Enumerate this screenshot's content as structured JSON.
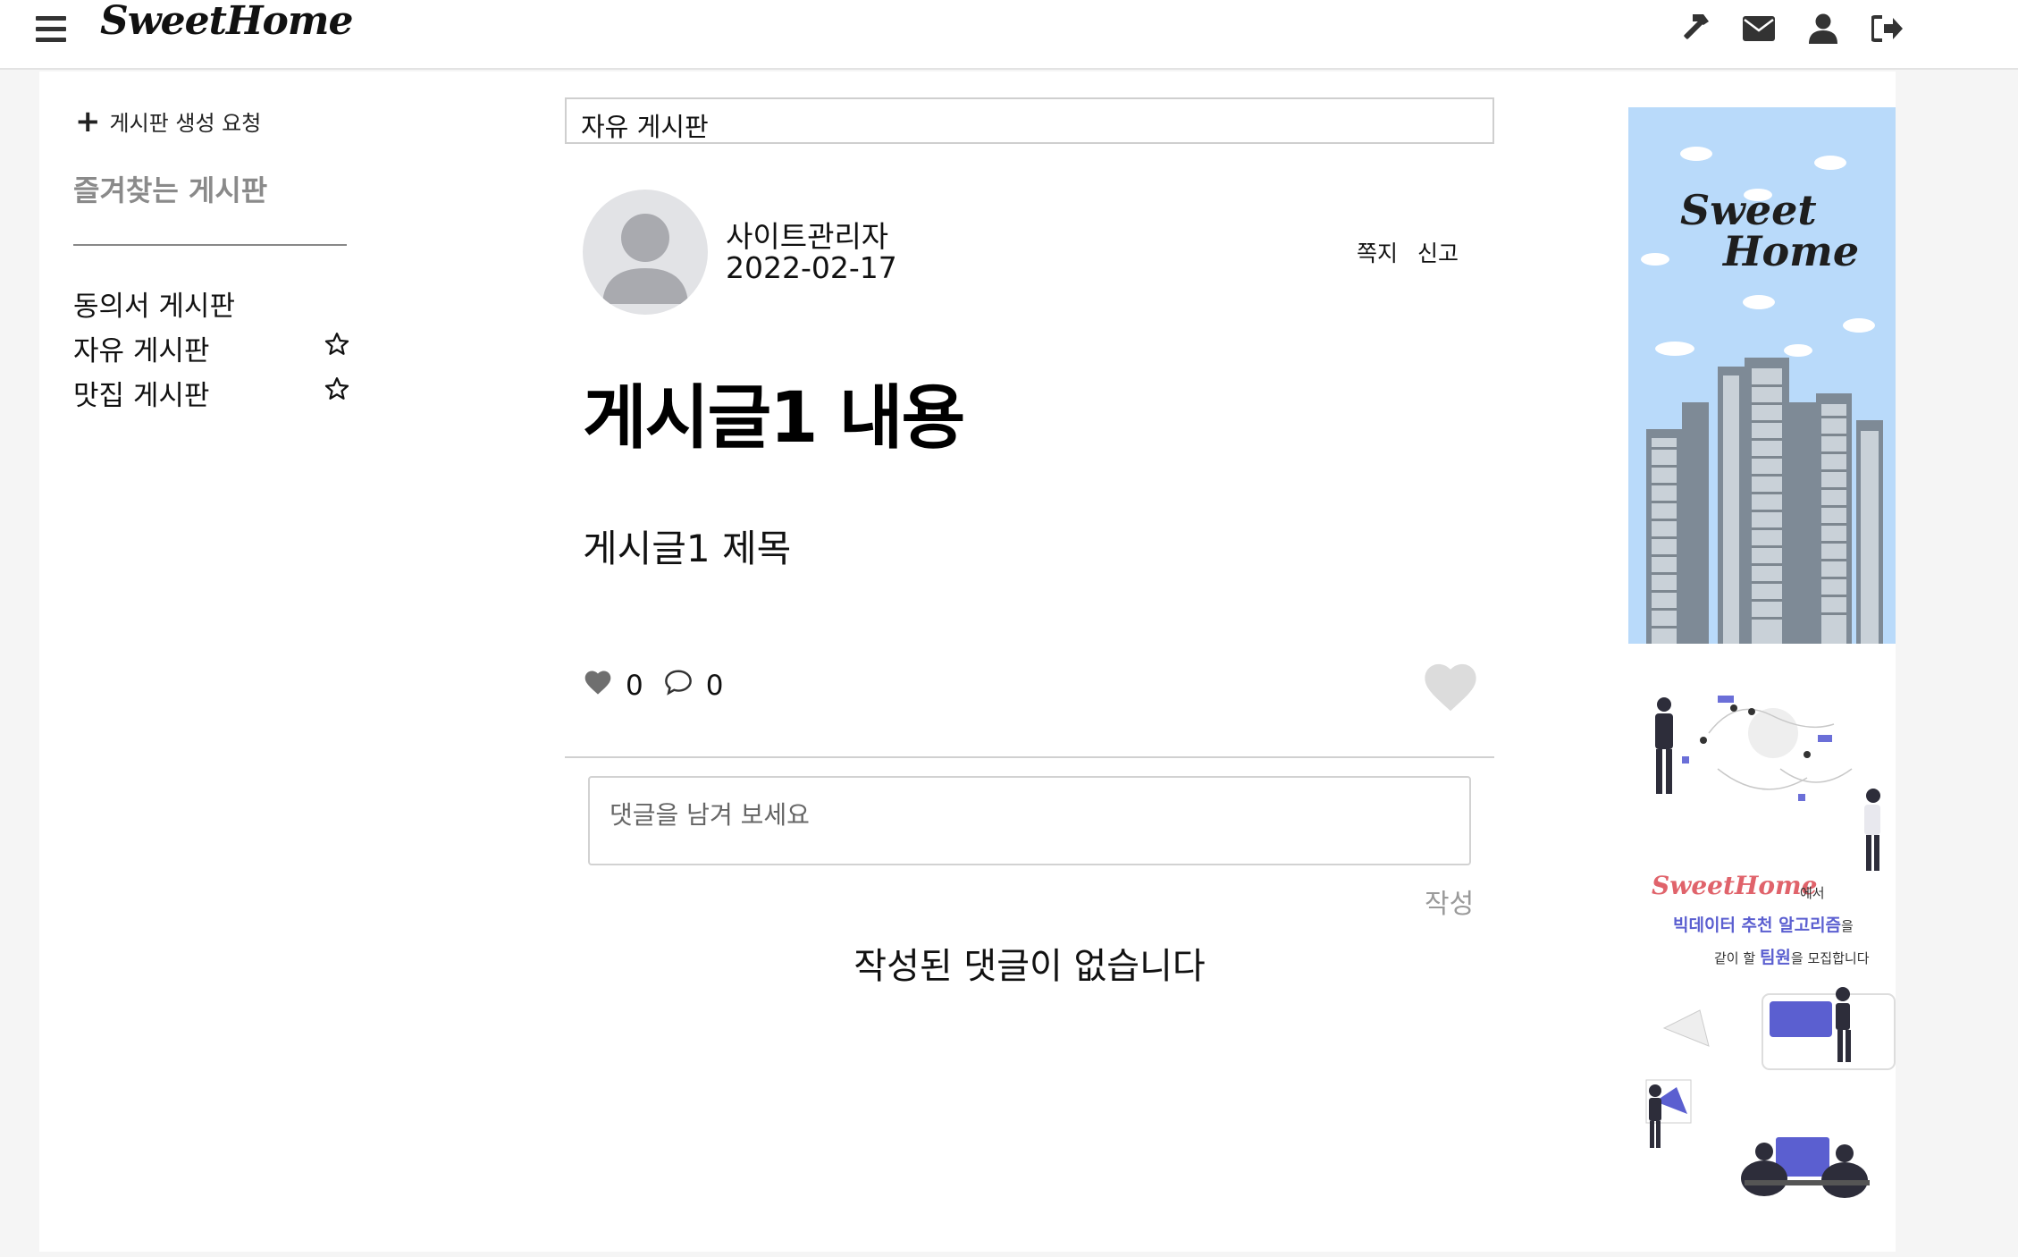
{
  "header": {
    "logo": "SweetHome",
    "icons": [
      "hammer-icon",
      "envelope-icon",
      "user-icon",
      "sign-out-icon"
    ]
  },
  "sidebar": {
    "create_board": "게시판 생성 요청",
    "favorites_title": "즐겨찾는 게시판",
    "boards": [
      {
        "label": "동의서 게시판",
        "starred": false
      },
      {
        "label": "자유 게시판",
        "starred": true
      },
      {
        "label": "맛집 게시판",
        "starred": true
      }
    ]
  },
  "post": {
    "board_name": "자유 게시판",
    "author": "사이트관리자",
    "date": "2022-02-17",
    "message_label": "쪽지",
    "report_label": "신고",
    "heading": "게시글1 내용",
    "body": "게시글1 제목",
    "like_count": "0",
    "comment_count": "0"
  },
  "comments": {
    "placeholder": "댓글을 남겨 보세요",
    "submit_label": "작성",
    "empty_text": "작성된 댓글이 없습니다"
  },
  "ads": {
    "top_logo_line1": "Sweet",
    "top_logo_line2": "Home",
    "bottom_brand": "SweetHome",
    "bottom_suffix": "에서",
    "bottom_line2": "빅데이터 추천 알고리즘",
    "bottom_line2_suffix": "을",
    "bottom_line3_prefix": "같이 할",
    "bottom_line3_highlight": "팀원",
    "bottom_line3_suffix": "을 모집합니다"
  },
  "colors": {
    "accent_pink": "#e0636b",
    "accent_purple": "#5b5fd0",
    "sky": "#b9dafa"
  }
}
